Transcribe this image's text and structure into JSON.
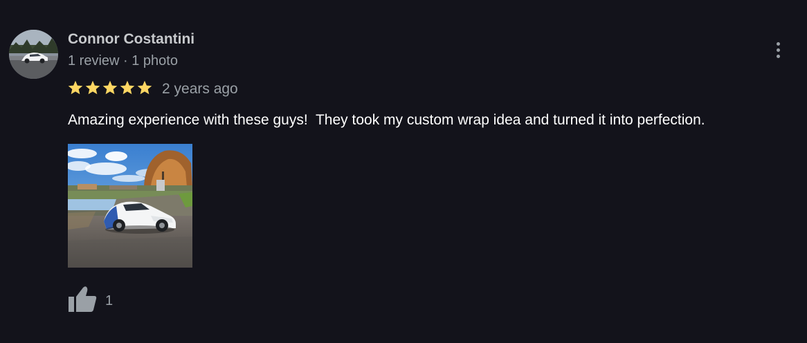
{
  "review": {
    "author": {
      "name": "Connor Costantini",
      "meta": "1 review · 1 photo"
    },
    "rating": 5,
    "date": "2 years ago",
    "text": "Amazing experience with these guys!  They took my custom wrap idea and turned it into perfection.",
    "likes": "1"
  },
  "colors": {
    "background": "#13131b",
    "star": "#fdd663",
    "secondary_text": "#9aa0a6",
    "primary_text": "#ffffff"
  },
  "icons": {
    "more": "more-vert-icon",
    "like": "thumb-up-icon",
    "star": "star-icon"
  }
}
